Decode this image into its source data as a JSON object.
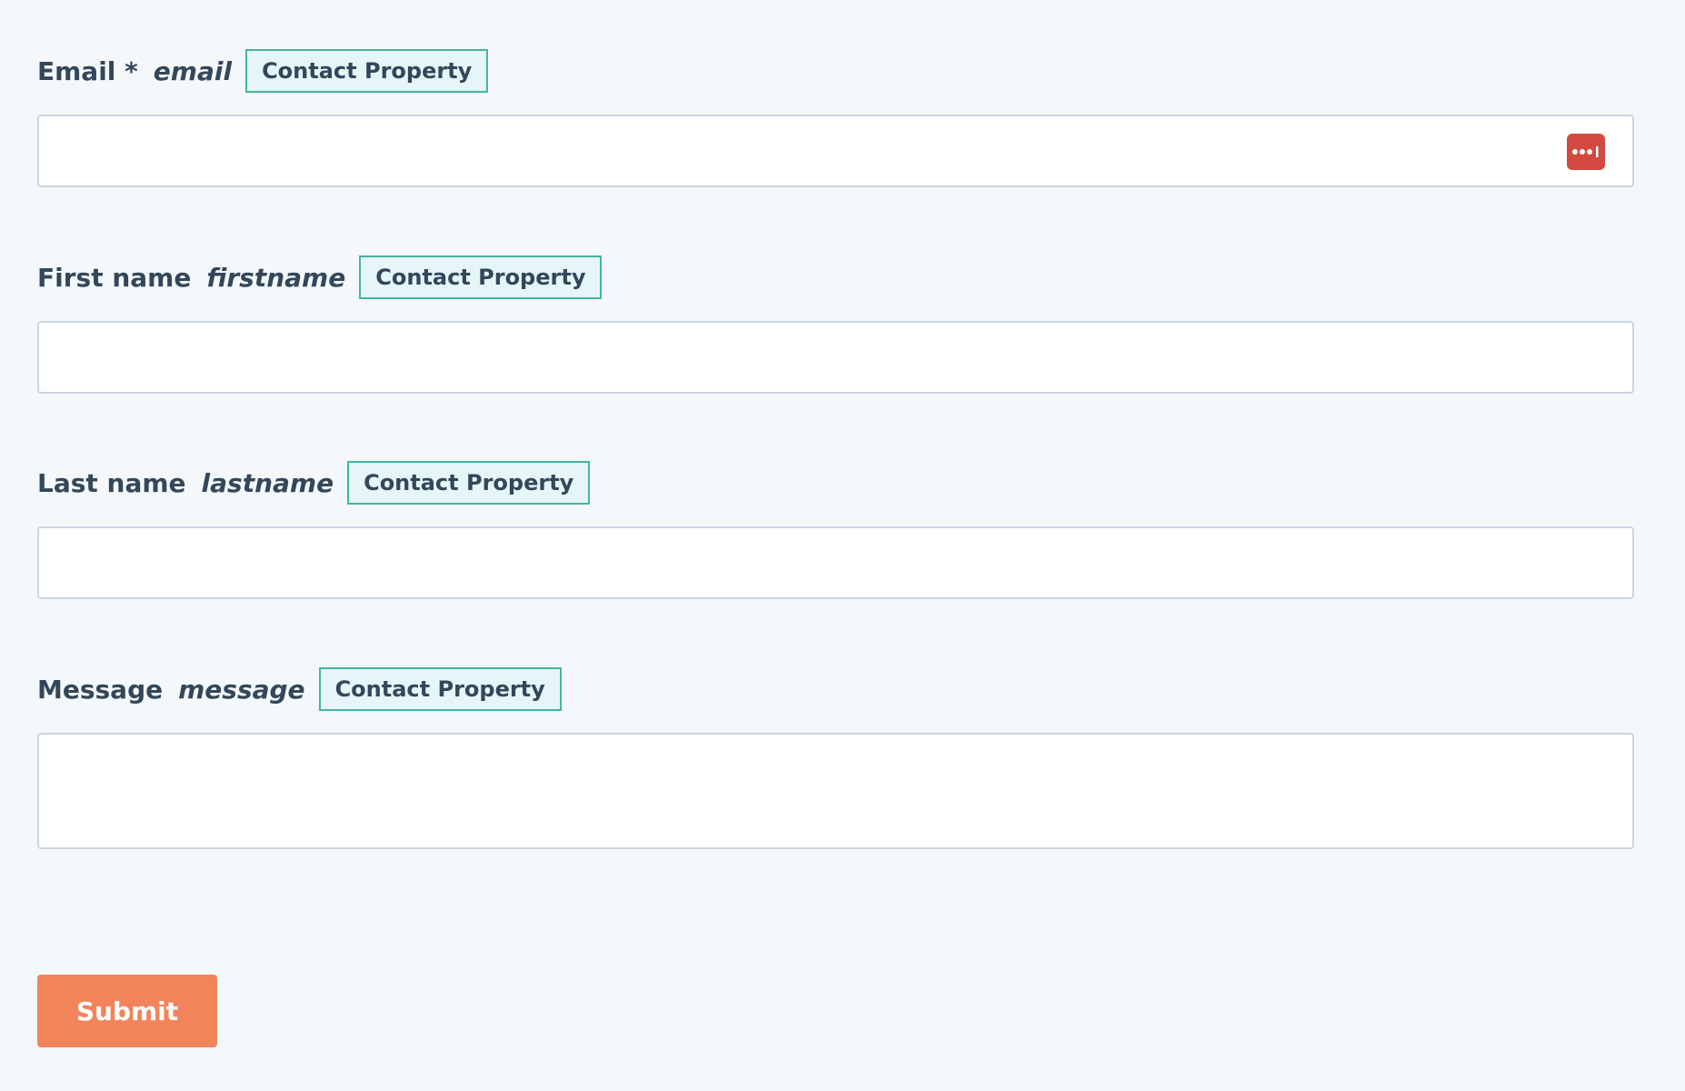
{
  "form": {
    "fields": [
      {
        "label": "Email *",
        "property": "email",
        "tag": "Contact Property",
        "value": "",
        "placeholder": ""
      },
      {
        "label": "First name",
        "property": "firstname",
        "tag": "Contact Property",
        "value": "",
        "placeholder": ""
      },
      {
        "label": "Last name",
        "property": "lastname",
        "tag": "Contact Property",
        "value": "",
        "placeholder": ""
      },
      {
        "label": "Message",
        "property": "message",
        "tag": "Contact Property",
        "value": "",
        "placeholder": ""
      }
    ],
    "submit_label": "Submit",
    "password_manager_icon": "password-manager-icon"
  },
  "colors": {
    "background": "#f5f8fa",
    "text": "#33475b",
    "tag_border": "#45b5a0",
    "tag_background": "#e5f5f8",
    "input_border": "#cbd6e2",
    "submit_background": "#f2845c",
    "password_icon_background": "#d3493f"
  }
}
